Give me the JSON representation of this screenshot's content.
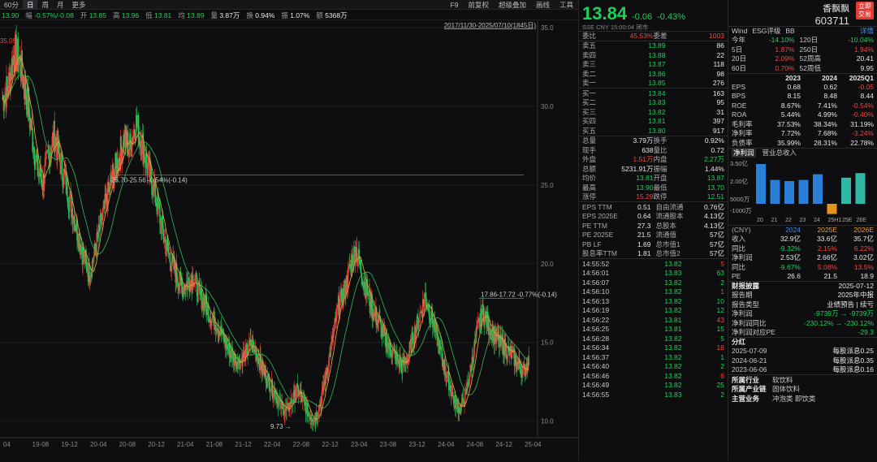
{
  "toolbar": {
    "tabs": [
      "60分",
      "日",
      "周",
      "月",
      "更多"
    ],
    "active": 1,
    "right_items": [
      "F9",
      "前复权",
      "超级叠加",
      "画线",
      "工具"
    ]
  },
  "infobar": [
    {
      "label": "",
      "value": "13.90",
      "color": "green"
    },
    {
      "label": "幅",
      "value": "-0.57%/-0.08",
      "color": "green"
    },
    {
      "label": "开",
      "value": "13.85",
      "color": "green"
    },
    {
      "label": "高",
      "value": "13.96",
      "color": "green"
    },
    {
      "label": "低",
      "value": "13.81",
      "color": "green"
    },
    {
      "label": "均",
      "value": "13.89",
      "color": "green"
    },
    {
      "label": "量",
      "value": "3.87万",
      "color": "white"
    },
    {
      "label": "换",
      "value": "0.94%",
      "color": "white"
    },
    {
      "label": "振",
      "value": "1.07%",
      "color": "white"
    },
    {
      "label": "额",
      "value": "5368万",
      "color": "white"
    }
  ],
  "chart_data": {
    "type": "candlestick",
    "range_label": "2017/11/30-2025/07/10(1845日)",
    "ylim": [
      9,
      35
    ],
    "y_ticks": [
      10,
      15,
      20,
      25,
      30,
      35
    ],
    "x_ticks": [
      "04",
      "19-08",
      "19-12",
      "20-04",
      "20-08",
      "20-12",
      "21-04",
      "21-08",
      "21-12",
      "22-04",
      "22-08",
      "22-12",
      "23-04",
      "23-08",
      "23-12",
      "24-04",
      "24-08",
      "24-12",
      "25-04"
    ],
    "close": [
      30.5,
      31.2,
      33.5,
      32.8,
      31.0,
      28.5,
      26.0,
      25.2,
      27.0,
      28.2,
      26.5,
      25.0,
      23.5,
      22.0,
      20.5,
      19.3,
      20.8,
      22.5,
      24.0,
      25.5,
      26.5,
      28.0,
      27.4,
      29.0,
      27.8,
      26.2,
      25.0,
      23.3,
      21.5,
      20.2,
      19.4,
      18.5,
      18.8,
      19.2,
      18.0,
      17.5,
      16.6,
      16.2,
      15.4,
      14.6,
      14.0,
      13.8,
      14.3,
      14.9,
      14.2,
      13.2,
      12.5,
      11.8,
      11.0,
      10.6,
      11.3,
      12.0,
      11.2,
      10.4,
      10.2,
      11.3,
      13.2,
      15.2,
      17.3,
      18.2,
      19.7,
      21.0,
      19.5,
      18.2,
      17.0,
      16.3,
      15.2,
      14.6,
      14.0,
      13.5,
      14.1,
      15.4,
      16.6,
      17.9,
      16.8,
      15.4,
      13.9,
      12.6,
      11.3,
      10.7,
      11.6,
      13.6,
      15.8,
      17.0,
      16.0,
      15.4,
      14.9,
      14.6,
      14.2,
      13.6,
      13.2,
      13.9
    ],
    "annotations": [
      {
        "text": "25.70-25.56  -0.54%(-0.14)"
      },
      {
        "text": "17.86-17.72  -0.77%(-0.14)"
      },
      {
        "text": "9.73"
      },
      {
        "text": "35.09"
      }
    ]
  },
  "quote": {
    "price": "13.84",
    "change": "-0.06",
    "pct": "-0.43%",
    "name": "香飘飘",
    "code": "603711",
    "button": "立即\n交易",
    "exchange": "SSE  CNY  15:00:04  闭市"
  },
  "order_ratio": {
    "label1": "委比",
    "value1": "45.53%",
    "label2": "委差",
    "value2": "1003"
  },
  "asks": [
    {
      "l": "卖五",
      "p": "13.89",
      "v": "86"
    },
    {
      "l": "卖四",
      "p": "13.88",
      "v": "22"
    },
    {
      "l": "卖三",
      "p": "13.87",
      "v": "118"
    },
    {
      "l": "卖二",
      "p": "13.86",
      "v": "98"
    },
    {
      "l": "卖一",
      "p": "13.85",
      "v": "276"
    }
  ],
  "bids": [
    {
      "l": "买一",
      "p": "13.84",
      "v": "163"
    },
    {
      "l": "买二",
      "p": "13.83",
      "v": "95"
    },
    {
      "l": "买三",
      "p": "13.82",
      "v": "31"
    },
    {
      "l": "买四",
      "p": "13.81",
      "v": "397"
    },
    {
      "l": "买五",
      "p": "13.80",
      "v": "917"
    }
  ],
  "stats": [
    [
      "总量",
      "3.79万",
      "换手",
      "0.92%"
    ],
    [
      "现手",
      "638",
      "量比",
      "0.72"
    ],
    [
      "外盘",
      "1.51万",
      "内盘",
      "2.27万"
    ],
    [
      "总额",
      "5231.91万",
      "振幅",
      "1.44%"
    ],
    [
      "均价",
      "13.81",
      "开盘",
      "13.87"
    ],
    [
      "最高",
      "13.90",
      "最低",
      "13.70"
    ],
    [
      "涨停",
      "15.29",
      "跌停",
      "12.51"
    ]
  ],
  "fund": [
    [
      "EPS TTM",
      "0.51",
      "自由流通",
      "0.76亿"
    ],
    [
      "EPS 2025E",
      "0.64",
      "流通股本",
      "4.13亿"
    ],
    [
      "PE TTM",
      "27.3",
      "总股本",
      "4.13亿"
    ],
    [
      "PE 2025E",
      "21.5",
      "流通值",
      "57亿"
    ],
    [
      "PB LF",
      "1.69",
      "总市值1",
      "57亿"
    ],
    [
      "股息率TTM",
      "1.81",
      "总市值2",
      "57亿"
    ]
  ],
  "ticks": [
    [
      "14:55:52",
      "13.82",
      "5"
    ],
    [
      "14:56:01",
      "13.83",
      "63"
    ],
    [
      "14:56:07",
      "13.82",
      "2"
    ],
    [
      "14:56:10",
      "13.82",
      "1"
    ],
    [
      "14:56:13",
      "13.82",
      "10"
    ],
    [
      "14:56:19",
      "13.82",
      "12"
    ],
    [
      "14:56:22",
      "13.81",
      "43"
    ],
    [
      "14:56:25",
      "13.81",
      "15"
    ],
    [
      "14:56:28",
      "13.82",
      "5"
    ],
    [
      "14:56:34",
      "13.82",
      "18"
    ],
    [
      "14:56:37",
      "13.82",
      "1"
    ],
    [
      "14:56:40",
      "13.82",
      "2"
    ],
    [
      "14:56:46",
      "13.82",
      "6"
    ],
    [
      "14:56:49",
      "13.82",
      "25"
    ],
    [
      "14:56:55",
      "13.83",
      "2"
    ]
  ],
  "fin": {
    "tabs": [
      "Wind",
      "ESG评级",
      "BB"
    ],
    "detail": "详情",
    "perf": [
      [
        "今年",
        "-14.10%",
        "120日",
        "-10.04%"
      ],
      [
        "5日",
        "1.87%",
        "250日",
        "1.94%"
      ],
      [
        "20日",
        "2.09%",
        "52周高",
        "20.41"
      ],
      [
        "60日",
        "0.70%",
        "52周低",
        "9.95"
      ]
    ],
    "years": [
      "2023",
      "2024",
      "2025Q1"
    ],
    "metrics": [
      [
        "EPS",
        "0.68",
        "0.62",
        "-0.05"
      ],
      [
        "BPS",
        "8.15",
        "8.48",
        "8.44"
      ],
      [
        "ROE",
        "8.67%",
        "7.41%",
        "-0.54%"
      ],
      [
        "ROA",
        "5.44%",
        "4.99%",
        "-0.40%"
      ],
      [
        "毛利率",
        "37.53%",
        "38.34%",
        "31.19%"
      ],
      [
        "净利率",
        "7.72%",
        "7.68%",
        "-3.24%"
      ],
      [
        "负债率",
        "35.99%",
        "28.31%",
        "22.78%"
      ]
    ],
    "chart_tabs": [
      "净利润",
      "营业总收入"
    ],
    "bar_chart": {
      "type": "bar",
      "categories": [
        "20",
        "21",
        "22",
        "23",
        "24",
        "25H1",
        "25E",
        "26E"
      ],
      "y_ticks": [
        "3.50亿",
        "2.00亿",
        "5000万",
        "-1000万"
      ],
      "values": [
        3.5,
        2.1,
        2.0,
        2.1,
        2.6,
        -0.9,
        2.3,
        2.7
      ]
    },
    "fc_header": [
      "(CNY)",
      "2024",
      "2025E",
      "2026E"
    ],
    "forecast": [
      [
        "收入",
        "32.9亿",
        "33.6亿",
        "35.7亿"
      ],
      [
        "同比",
        "-9.32%",
        "2.15%",
        "6.22%"
      ],
      [
        "净利润",
        "2.53亿",
        "2.66亿",
        "3.02亿"
      ],
      [
        "同比",
        "-9.67%",
        "5.08%",
        "13.5%"
      ],
      [
        "PE",
        "26.6",
        "21.5",
        "18.9"
      ]
    ],
    "report": {
      "title": "财报披露",
      "date": "2025-07-12",
      "rows": [
        [
          "报告期",
          "2025年中报"
        ],
        [
          "报告类型",
          "业绩预告 | 续亏"
        ],
        [
          "净利润",
          "-9739万 → -9739万"
        ],
        [
          "净利润同比",
          "-230.12% → -230.12%"
        ],
        [
          "净利润对应PE",
          "-29.3"
        ]
      ]
    },
    "dividend": {
      "title": "分红",
      "rows": [
        [
          "2025-07-09",
          "每股派息0.25"
        ],
        [
          "2024-06-21",
          "每股派息0.35"
        ],
        [
          "2023-06-06",
          "每股派息0.16"
        ]
      ]
    },
    "industry": [
      [
        "所属行业",
        "软饮料"
      ],
      [
        "所属产业链",
        "固体饮料"
      ],
      [
        "主营业务",
        "冲泡类  即饮类"
      ]
    ]
  }
}
